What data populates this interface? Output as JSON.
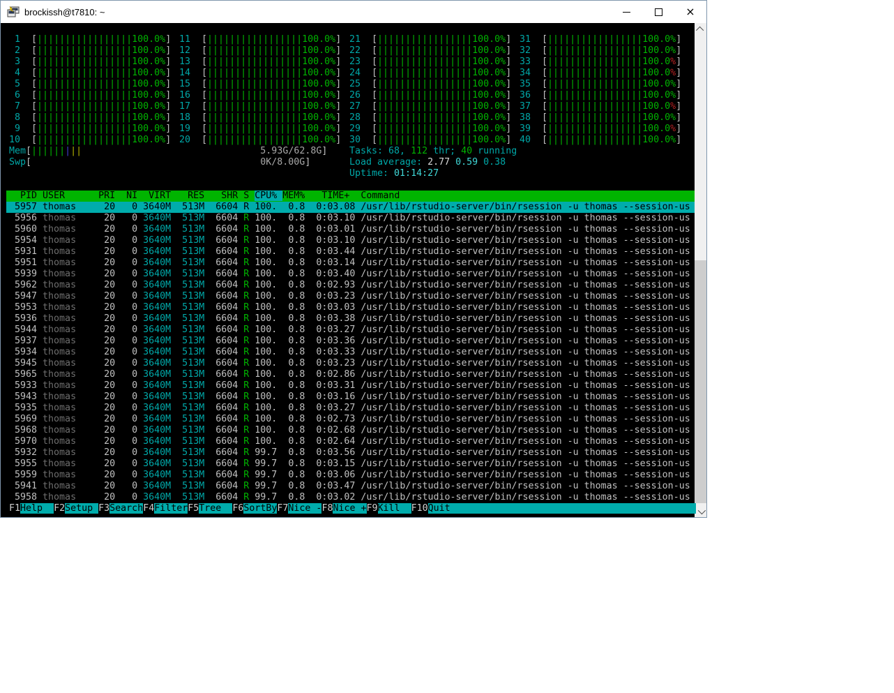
{
  "window": {
    "title": "brockissh@t7810: ~"
  },
  "colors": {
    "terminal_bg": "#000000",
    "text": "#c0c0c0",
    "cyan": "#00a8a8",
    "bright_cyan": "#40d8d8",
    "green": "#00b400",
    "red": "#b42222",
    "blue": "#4040d0",
    "yellow": "#b4b400",
    "header_bg": "#00b400",
    "selection_bg": "#00acac",
    "fkey_bg": "#00acac"
  },
  "cpu": {
    "count": 40,
    "meters": [
      [
        1,
        "100.0",
        0
      ],
      [
        2,
        "100.0",
        0
      ],
      [
        3,
        "100.0",
        0
      ],
      [
        4,
        "100.0",
        0
      ],
      [
        5,
        "100.0",
        0
      ],
      [
        6,
        "100.0",
        0
      ],
      [
        7,
        "100.0",
        0
      ],
      [
        8,
        "100.0",
        0
      ],
      [
        9,
        "100.0",
        0
      ],
      [
        10,
        "100.0",
        0
      ],
      [
        11,
        "100.0",
        0
      ],
      [
        12,
        "100.0",
        0
      ],
      [
        13,
        "100.0",
        0
      ],
      [
        14,
        "100.0",
        0
      ],
      [
        15,
        "100.0",
        0
      ],
      [
        16,
        "100.0",
        0
      ],
      [
        17,
        "100.0",
        0
      ],
      [
        18,
        "100.0",
        0
      ],
      [
        19,
        "100.0",
        0
      ],
      [
        20,
        "100.0",
        0
      ],
      [
        21,
        "100.0",
        0
      ],
      [
        22,
        "100.0",
        0
      ],
      [
        23,
        "100.0",
        0
      ],
      [
        24,
        "100.0",
        0
      ],
      [
        25,
        "100.0",
        0
      ],
      [
        26,
        "100.0",
        0
      ],
      [
        27,
        "100.0",
        0
      ],
      [
        28,
        "100.0",
        0
      ],
      [
        29,
        "100.0",
        0
      ],
      [
        30,
        "100.0",
        0
      ],
      [
        31,
        "100.0",
        0
      ],
      [
        32,
        "100.0",
        0
      ],
      [
        33,
        "100.0",
        1
      ],
      [
        34,
        "100.0",
        1
      ],
      [
        35,
        "100.0",
        0
      ],
      [
        36,
        "100.0",
        0
      ],
      [
        37,
        "100.0",
        1
      ],
      [
        38,
        "100.0",
        0
      ],
      [
        39,
        "100.0",
        1
      ],
      [
        40,
        "100.0",
        0
      ]
    ]
  },
  "memory": {
    "label": "Mem",
    "bars_green": 6,
    "bars_blue": 1,
    "bars_yellow": 2,
    "text": "5.93G/62.8G"
  },
  "swap": {
    "label": "Swp",
    "text": "0K/8.00G"
  },
  "status": {
    "tasks": [
      [
        "Tasks: 68, ",
        "cyan"
      ],
      [
        "112",
        "green"
      ],
      [
        " thr; ",
        "cyan"
      ],
      [
        "40",
        "green"
      ],
      [
        " running",
        "cyan"
      ]
    ],
    "load": [
      [
        "Load average: ",
        "cyan"
      ],
      [
        "2.77 ",
        "white"
      ],
      [
        "0.59 ",
        "bcyan"
      ],
      [
        "0.38",
        "cyan"
      ]
    ],
    "uptime": [
      [
        "Uptime: ",
        "cyan"
      ],
      [
        "01:14:27",
        "bcyan"
      ]
    ]
  },
  "table": {
    "header_left": "  PID USER      PRI  NI  VIRT   RES   SHR S ",
    "header_sort": "CPU% ",
    "header_right": "MEM%   TIME+  Command",
    "columns": [
      "PID",
      "USER",
      "PRI",
      "NI",
      "VIRT",
      "RES",
      "SHR",
      "S",
      "CPU%",
      "MEM%",
      "TIME+",
      "Command"
    ],
    "sort_column": "CPU%",
    "shared": {
      "user": "thomas",
      "pri": "20",
      "ni": "0",
      "virt": "3640M",
      "res": "513M",
      "shr": "6604",
      "s": "R",
      "mem": "0.8",
      "command": "/usr/lib/rstudio-server/bin/rsession -u thomas --session-us"
    },
    "rows": [
      {
        "pid": "5957",
        "cpu": "100.",
        "time": "0:03.08",
        "selected": true
      },
      {
        "pid": "5956",
        "cpu": "100.",
        "time": "0:03.10",
        "selected": false
      },
      {
        "pid": "5960",
        "cpu": "100.",
        "time": "0:03.01",
        "selected": false
      },
      {
        "pid": "5954",
        "cpu": "100.",
        "time": "0:03.10",
        "selected": false
      },
      {
        "pid": "5931",
        "cpu": "100.",
        "time": "0:03.44",
        "selected": false
      },
      {
        "pid": "5951",
        "cpu": "100.",
        "time": "0:03.14",
        "selected": false
      },
      {
        "pid": "5939",
        "cpu": "100.",
        "time": "0:03.40",
        "selected": false
      },
      {
        "pid": "5962",
        "cpu": "100.",
        "time": "0:02.93",
        "selected": false
      },
      {
        "pid": "5947",
        "cpu": "100.",
        "time": "0:03.23",
        "selected": false
      },
      {
        "pid": "5953",
        "cpu": "100.",
        "time": "0:03.03",
        "selected": false
      },
      {
        "pid": "5936",
        "cpu": "100.",
        "time": "0:03.38",
        "selected": false
      },
      {
        "pid": "5944",
        "cpu": "100.",
        "time": "0:03.27",
        "selected": false
      },
      {
        "pid": "5937",
        "cpu": "100.",
        "time": "0:03.36",
        "selected": false
      },
      {
        "pid": "5934",
        "cpu": "100.",
        "time": "0:03.33",
        "selected": false
      },
      {
        "pid": "5945",
        "cpu": "100.",
        "time": "0:03.23",
        "selected": false
      },
      {
        "pid": "5965",
        "cpu": "100.",
        "time": "0:02.86",
        "selected": false
      },
      {
        "pid": "5933",
        "cpu": "100.",
        "time": "0:03.31",
        "selected": false
      },
      {
        "pid": "5943",
        "cpu": "100.",
        "time": "0:03.16",
        "selected": false
      },
      {
        "pid": "5935",
        "cpu": "100.",
        "time": "0:03.27",
        "selected": false
      },
      {
        "pid": "5969",
        "cpu": "100.",
        "time": "0:02.73",
        "selected": false
      },
      {
        "pid": "5968",
        "cpu": "100.",
        "time": "0:02.68",
        "selected": false
      },
      {
        "pid": "5970",
        "cpu": "100.",
        "time": "0:02.64",
        "selected": false
      },
      {
        "pid": "5932",
        "cpu": "99.7",
        "time": "0:03.56",
        "selected": false
      },
      {
        "pid": "5955",
        "cpu": "99.7",
        "time": "0:03.15",
        "selected": false
      },
      {
        "pid": "5959",
        "cpu": "99.7",
        "time": "0:03.06",
        "selected": false
      },
      {
        "pid": "5941",
        "cpu": "99.7",
        "time": "0:03.47",
        "selected": false
      },
      {
        "pid": "5958",
        "cpu": "99.7",
        "time": "0:03.02",
        "selected": false
      }
    ]
  },
  "fkeys": [
    {
      "key": "F1",
      "label": "Help"
    },
    {
      "key": "F2",
      "label": "Setup"
    },
    {
      "key": "F3",
      "label": "Search"
    },
    {
      "key": "F4",
      "label": "Filter"
    },
    {
      "key": "F5",
      "label": "Tree"
    },
    {
      "key": "F6",
      "label": "SortBy"
    },
    {
      "key": "F7",
      "label": "Nice -"
    },
    {
      "key": "F8",
      "label": "Nice +"
    },
    {
      "key": "F9",
      "label": "Kill"
    },
    {
      "key": "F10",
      "label": "Quit"
    }
  ]
}
